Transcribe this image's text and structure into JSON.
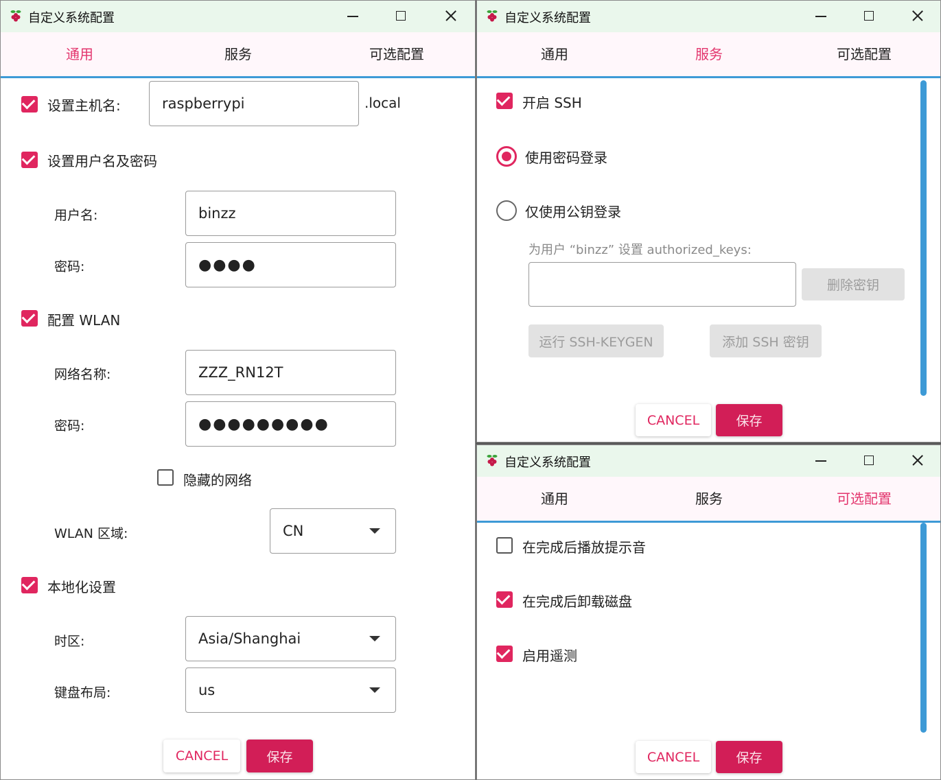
{
  "window_title": "自定义系统配置",
  "tabs": {
    "general": "通用",
    "services": "服务",
    "options": "可选配置"
  },
  "buttons": {
    "cancel": "CANCEL",
    "save": "保存"
  },
  "colors": {
    "accent": "#e0265f",
    "tab_underline": "#3d9ad6",
    "titlebar": "#eaf7ec"
  },
  "general": {
    "hostname": {
      "label": "设置主机名:",
      "checked": true,
      "value": "raspberrypi",
      "suffix": ".local"
    },
    "user": {
      "label": "设置用户名及密码",
      "checked": true,
      "username_label": "用户名:",
      "username_value": "binzz",
      "password_label": "密码:",
      "password_value": "●●●●"
    },
    "wlan": {
      "label": "配置 WLAN",
      "checked": true,
      "ssid_label": "网络名称:",
      "ssid_value": "ZZZ_RN12T",
      "password_label": "密码:",
      "password_value": "●●●●●●●●●",
      "hidden_label": "隐藏的网络",
      "hidden_checked": false,
      "country_label": "WLAN 区域:",
      "country_value": "CN"
    },
    "locale": {
      "label": "本地化设置",
      "checked": true,
      "timezone_label": "时区:",
      "timezone_value": "Asia/Shanghai",
      "keyboard_label": "键盘布局:",
      "keyboard_value": "us"
    }
  },
  "services": {
    "ssh_label": "开启 SSH",
    "ssh_checked": true,
    "password_auth_label": "使用密码登录",
    "password_auth_selected": true,
    "pubkey_auth_label": "仅使用公钥登录",
    "pubkey_auth_selected": false,
    "authorized_keys_label": "为用户 “binzz” 设置 authorized_keys:",
    "authorized_keys_value": "",
    "delete_key_label": "删除密钥",
    "keygen_label": "运行 SSH-KEYGEN",
    "add_key_label": "添加 SSH 密钥"
  },
  "options": {
    "sound_label": "在完成后播放提示音",
    "sound_checked": false,
    "eject_label": "在完成后卸载磁盘",
    "eject_checked": true,
    "telemetry_label": "启用遥测",
    "telemetry_checked": true
  }
}
